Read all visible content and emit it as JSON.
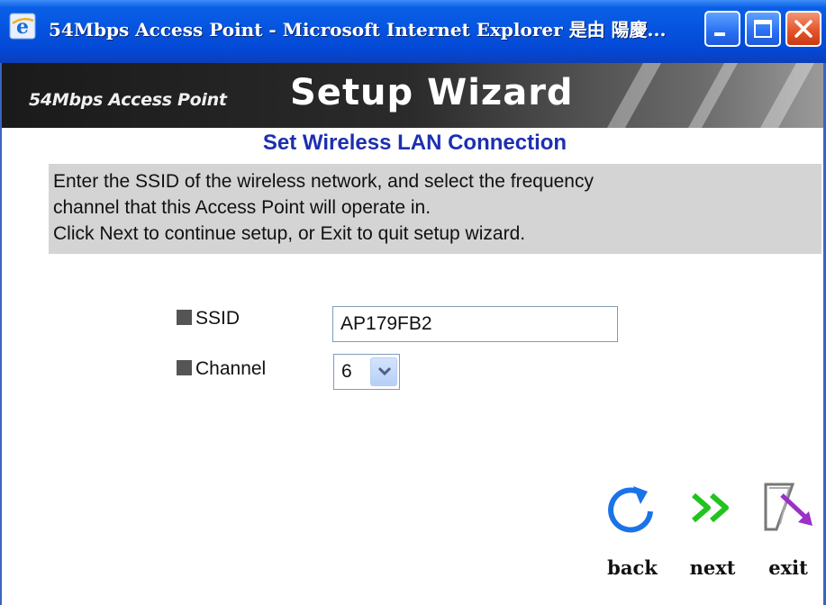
{
  "window": {
    "title": "54Mbps Access Point - Microsoft Internet Explorer 是由 陽慶..."
  },
  "banner": {
    "product": "54Mbps Access Point",
    "heading": "Setup Wizard"
  },
  "page": {
    "title": "Set Wireless LAN Connection",
    "description_lines": [
      "Enter the SSID of the wireless network, and select the frequency",
      "channel that this Access Point will operate in.",
      "Click Next to continue setup, or Exit to quit setup wizard."
    ]
  },
  "form": {
    "ssid_label": "SSID",
    "ssid_value": "AP179FB2",
    "channel_label": "Channel",
    "channel_value": "6"
  },
  "nav": {
    "back_label": "back",
    "next_label": "next",
    "exit_label": "exit"
  },
  "colors": {
    "title_bar": "#0554e0",
    "page_title": "#1d2fb0",
    "description_bg": "#d4d4d4",
    "back_icon": "#1a73e8",
    "next_icon": "#22c31e",
    "exit_icon": "#9b2fc8"
  },
  "icons": {
    "app": "ie-icon",
    "minimize": "minimize-icon",
    "maximize": "maximize-icon",
    "close": "close-icon",
    "back": "refresh-arrow-icon",
    "next": "double-chevron-right-icon",
    "exit": "exit-door-arrow-icon",
    "dropdown": "chevron-down-icon"
  }
}
